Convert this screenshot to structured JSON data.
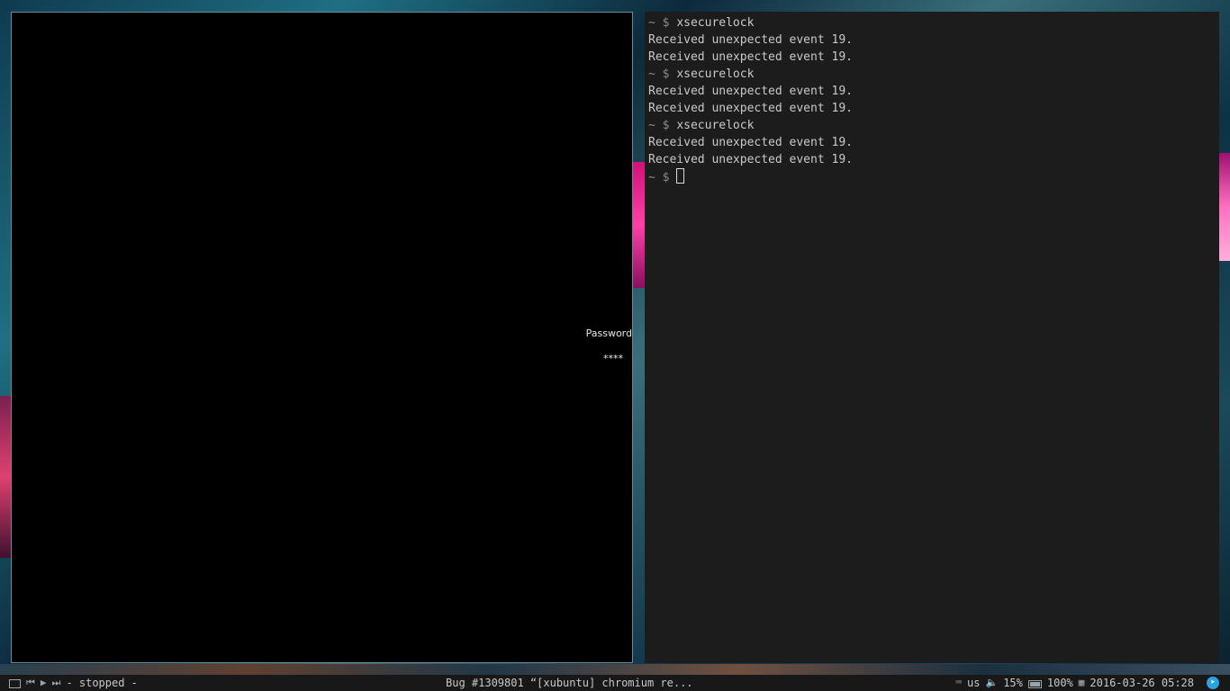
{
  "lock_screen": {
    "prompt_label": "Password",
    "password_mask": "****"
  },
  "terminal": {
    "lines": [
      {
        "prompt": "~ $",
        "text": "xsecurelock"
      },
      {
        "prompt": "",
        "text": "Received unexpected event 19."
      },
      {
        "prompt": "",
        "text": "Received unexpected event 19."
      },
      {
        "prompt": "~ $",
        "text": "xsecurelock"
      },
      {
        "prompt": "",
        "text": "Received unexpected event 19."
      },
      {
        "prompt": "",
        "text": "Received unexpected event 19."
      },
      {
        "prompt": "~ $",
        "text": "xsecurelock"
      },
      {
        "prompt": "",
        "text": "Received unexpected event 19."
      },
      {
        "prompt": "",
        "text": "Received unexpected event 19."
      }
    ],
    "current_prompt": "~ $"
  },
  "panel": {
    "media": {
      "status": "- stopped -",
      "icons": [
        "screenshot-icon",
        "previous-track-icon",
        "play-icon",
        "next-track-icon"
      ]
    },
    "active_window_title": "Bug #1309801 “[xubuntu] chromium re...",
    "keyboard_layout": "us",
    "volume": "15%",
    "battery": "100%",
    "datetime": "2016-03-26 05:28",
    "tray_icons": [
      "keyboard-icon",
      "volume-icon",
      "battery-icon",
      "calendar-icon",
      "telegram-icon"
    ]
  },
  "colors": {
    "terminal_bg": "#1c1c1c",
    "terminal_fg": "#c9c9c9",
    "panel_bg": "#181818",
    "lock_bg": "#000000",
    "telegram_accent": "#2aa3e0"
  }
}
